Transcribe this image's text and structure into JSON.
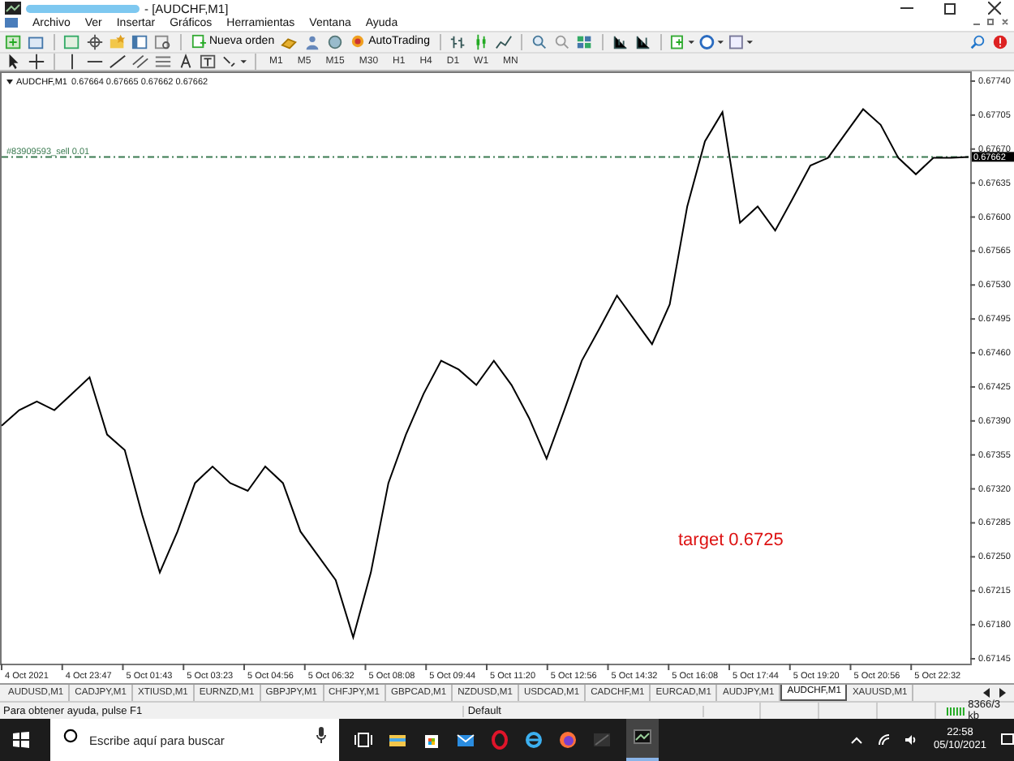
{
  "window": {
    "title": "- [AUDCHF,M1]"
  },
  "menu": [
    "Archivo",
    "Ver",
    "Insertar",
    "Gráficos",
    "Herramientas",
    "Ventana",
    "Ayuda"
  ],
  "toolbar": {
    "buttons": [
      {
        "label": "Nueva orden"
      },
      {
        "label": "AutoTrading"
      }
    ],
    "timeframes": [
      "M1",
      "M5",
      "M15",
      "M30",
      "H1",
      "H4",
      "D1",
      "W1",
      "MN"
    ]
  },
  "chart": {
    "price_label": "0.67662",
    "ohlc": "0.67664 0.67665 0.67662 0.67662",
    "target_label": "target 0.6725",
    "time_labels": [
      "4 Oct 2021",
      "4 Oct 23:47",
      "5 Oct 01:43",
      "5 Oct 03:23",
      "5 Oct 04:56",
      "5 Oct 06:32",
      "5 Oct 08:08",
      "5 Oct 09:44",
      "5 Oct 11:20",
      "5 Oct 12:56",
      "5 Oct 14:32",
      "5 Oct 16:08",
      "5 Oct 17:44",
      "5 Oct 19:20",
      "5 Oct 20:56",
      "5 Oct 22:32"
    ],
    "chart_data": {
      "type": "line",
      "ylim": [
        0.6714,
        0.6775
      ],
      "yticks": [
        {
          "value": 0.6774,
          "label": "0.67740"
        },
        {
          "value": 0.67705,
          "label": "0.67705"
        },
        {
          "value": 0.6767,
          "label": "0.67670"
        },
        {
          "value": 0.67635,
          "label": "0.67635"
        },
        {
          "value": 0.676,
          "label": "0.67600"
        },
        {
          "value": 0.67565,
          "label": "0.67565"
        },
        {
          "value": 0.6753,
          "label": "0.67530"
        },
        {
          "value": 0.67495,
          "label": "0.67495"
        },
        {
          "value": 0.6746,
          "label": "0.67460"
        },
        {
          "value": 0.67425,
          "label": "0.67425"
        },
        {
          "value": 0.6739,
          "label": "0.67390"
        },
        {
          "value": 0.67355,
          "label": "0.67355"
        },
        {
          "value": 0.6732,
          "label": "0.67320"
        },
        {
          "value": 0.67285,
          "label": "0.67285"
        },
        {
          "value": 0.6725,
          "label": "0.67250"
        },
        {
          "value": 0.67215,
          "label": "0.67215"
        },
        {
          "value": 0.6718,
          "label": "0.67180"
        },
        {
          "value": 0.67145,
          "label": "0.67145"
        }
      ],
      "series": [
        {
          "name": "AUDCHF,M1",
          "color": "#000000",
          "values": [
            0.67385,
            0.67401,
            0.6741,
            0.67401,
            0.67418,
            0.67435,
            0.67376,
            0.6736,
            0.67293,
            0.67234,
            0.67276,
            0.67326,
            0.67343,
            0.67326,
            0.67318,
            0.67343,
            0.67326,
            0.67276,
            0.67251,
            0.67226,
            0.67167,
            0.67234,
            0.67326,
            0.67376,
            0.67418,
            0.67452,
            0.67443,
            0.67427,
            0.67452,
            0.67427,
            0.67393,
            0.67351,
            0.67401,
            0.67452,
            0.67485,
            0.67519,
            0.67494,
            0.67469,
            0.6751,
            0.67611,
            0.67678,
            0.67708,
            0.67594,
            0.67611,
            0.67586,
            0.67619,
            0.67653,
            0.67661,
            0.67686,
            0.67711,
            0.67695,
            0.67661,
            0.67644,
            0.67661,
            0.67661,
            0.67662
          ]
        },
        {
          "name": "#83909593_sell 0.01",
          "color": "#3a7a50",
          "line_style": "dashed",
          "values": [
            0.67662,
            0.67662,
            0.67662,
            0.67662,
            0.67662,
            0.67662,
            0.67662,
            0.67662,
            0.67662,
            0.67662,
            0.67662,
            0.67662,
            0.67662,
            0.67662,
            0.67662,
            0.67662,
            0.67662,
            0.67662,
            0.67662,
            0.67662,
            0.67662,
            0.67662,
            0.67662,
            0.67662,
            0.67662,
            0.67662,
            0.67662,
            0.67662,
            0.67662,
            0.67662,
            0.67662,
            0.67662,
            0.67662,
            0.67662,
            0.67662,
            0.67662,
            0.67662,
            0.67662,
            0.67662,
            0.67662,
            0.67662,
            0.67662,
            0.67662,
            0.67662,
            0.67662,
            0.67662,
            0.67662,
            0.67662,
            0.67662,
            0.67662,
            0.67662,
            0.67662,
            0.67662,
            0.67662,
            0.67662,
            0.67662
          ]
        }
      ]
    }
  },
  "tabs": [
    {
      "label": "AUDUSD,M1",
      "selected": false
    },
    {
      "label": "CADJPY,M1",
      "selected": false
    },
    {
      "label": "XTIUSD,M1",
      "selected": false
    },
    {
      "label": "EURNZD,M1",
      "selected": false
    },
    {
      "label": "GBPJPY,M1",
      "selected": false
    },
    {
      "label": "CHFJPY,M1",
      "selected": false
    },
    {
      "label": "GBPCAD,M1",
      "selected": false
    },
    {
      "label": "NZDUSD,M1",
      "selected": false
    },
    {
      "label": "USDCAD,M1",
      "selected": false
    },
    {
      "label": "CADCHF,M1",
      "selected": false
    },
    {
      "label": "EURCAD,M1",
      "selected": false
    },
    {
      "label": "AUDJPY,M1",
      "selected": false
    },
    {
      "label": "AUDCHF,M1",
      "selected": true
    },
    {
      "label": "XAUUSD,M1",
      "selected": false
    }
  ],
  "status_bar": {
    "help": "Para obtener ayuda, pulse F1",
    "profile": "Default",
    "traffic": "8366/3 kb"
  },
  "taskbar": {
    "search_placeholder": "Escribe aquí para buscar",
    "time": "22:58",
    "date": "05/10/2021"
  }
}
